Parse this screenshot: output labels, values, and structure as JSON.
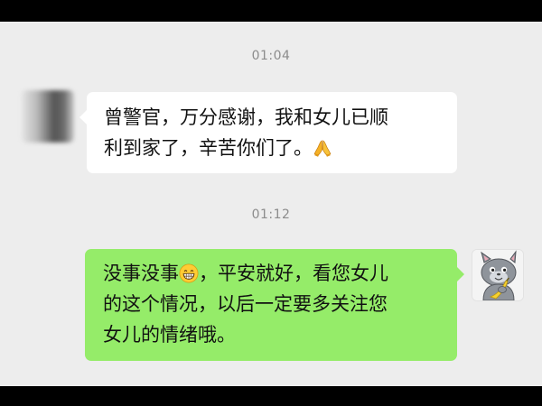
{
  "timestamps": [
    "01:04",
    "01:12"
  ],
  "messages": [
    {
      "side": "left",
      "lines": [
        "曾警官，万分感谢，我和女儿已顺",
        "利到家了，辛苦你们了。"
      ],
      "trailing_emoji": "folded-hands"
    },
    {
      "side": "right",
      "line1_before": "没事没事",
      "line1_emoji": "grinning-face",
      "line1_after": "，平安就好，看您女儿",
      "lines_rest": [
        "的这个情况，以后一定要多关注您",
        "女儿的情绪哦。"
      ]
    }
  ],
  "colors": {
    "chat_background": "#ededed",
    "incoming_bubble": "#ffffff",
    "outgoing_bubble": "#95ec69",
    "timestamp_text": "#8c8c8c"
  }
}
